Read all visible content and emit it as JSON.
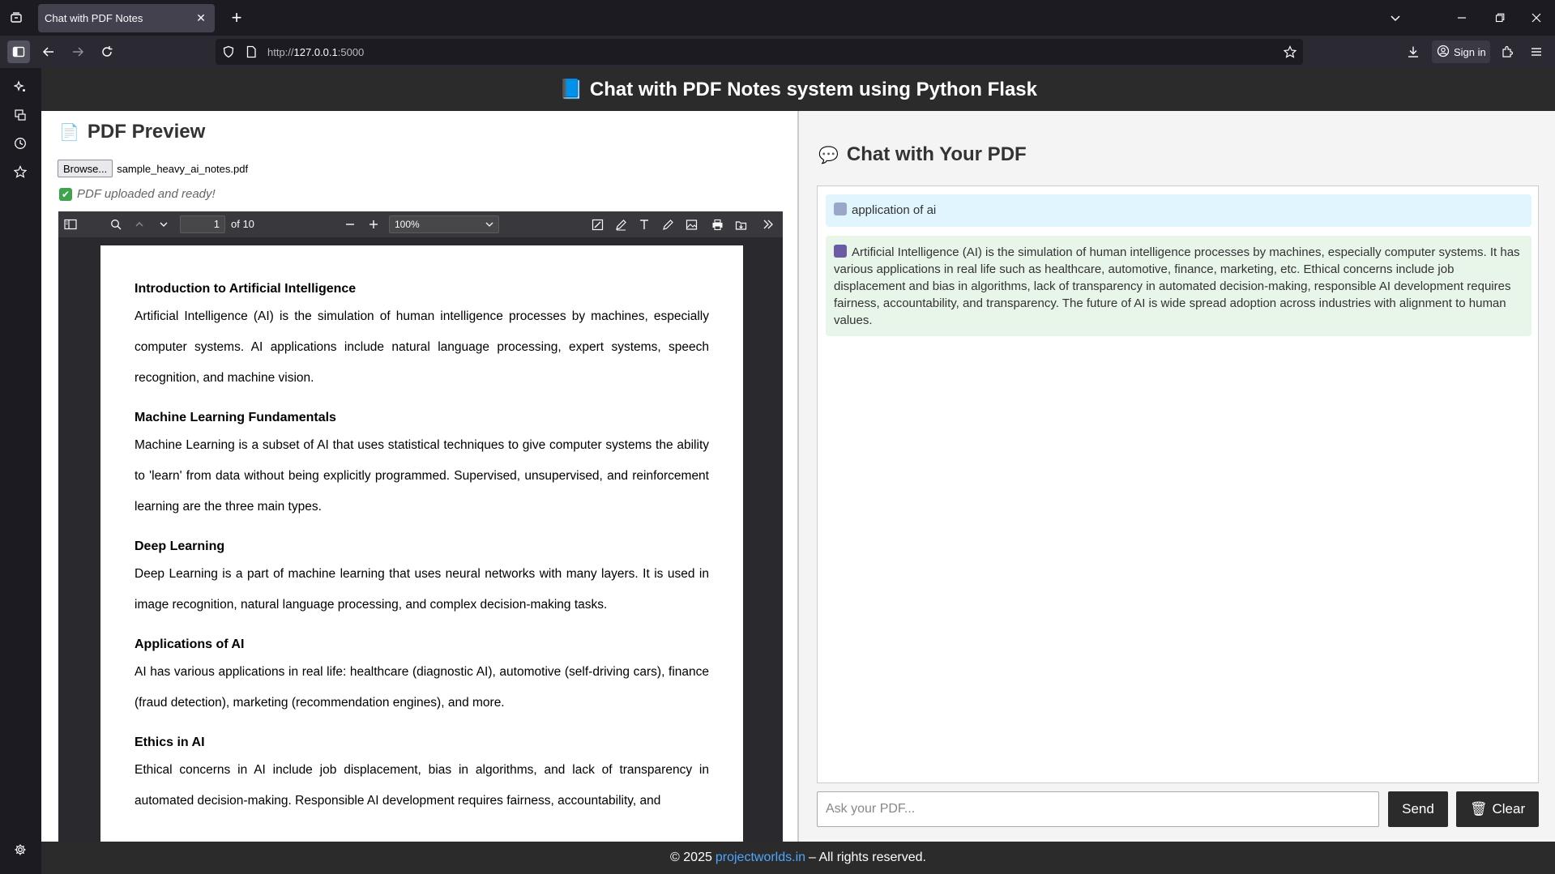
{
  "browser": {
    "tab_title": "Chat with PDF Notes",
    "tab_close": "✕",
    "new_tab": "+",
    "url_prefix": "http://",
    "url_host": "127.0.0.1",
    "url_port": ":5000",
    "sign_in": "Sign in"
  },
  "header": {
    "icon": "📘",
    "title": "Chat with PDF Notes system using Python Flask"
  },
  "left": {
    "icon": "📄",
    "title": "PDF Preview",
    "browse_label": "Browse...",
    "file_name": "sample_heavy_ai_notes.pdf",
    "status_icon": "✔",
    "status_text": "PDF uploaded and ready!"
  },
  "viewer": {
    "page_number": "1",
    "page_of": "of 10",
    "zoom": "100%",
    "sections": [
      {
        "heading": "Introduction to Artificial Intelligence",
        "body": "Artificial Intelligence (AI) is the simulation of human intelligence processes by machines, especially computer systems. AI applications include natural language processing, expert systems, speech recognition, and machine vision."
      },
      {
        "heading": "Machine Learning Fundamentals",
        "body": "Machine Learning is a subset of AI that uses statistical techniques to give computer systems the ability to 'learn' from data without being explicitly programmed. Supervised, unsupervised, and reinforcement learning are the three main types."
      },
      {
        "heading": "Deep Learning",
        "body": "Deep Learning is a part of machine learning that uses neural networks with many layers. It is used in image recognition, natural language processing, and complex decision-making tasks."
      },
      {
        "heading": "Applications of AI",
        "body": "AI has various applications in real life: healthcare (diagnostic AI), automotive (self-driving cars), finance (fraud detection), marketing (recommendation engines), and more."
      },
      {
        "heading": "Ethics in AI",
        "body": "Ethical concerns in AI include job displacement, bias in algorithms, and lack of transparency in automated decision-making. Responsible AI development requires fairness, accountability, and"
      }
    ]
  },
  "right": {
    "icon": "💬",
    "title": "Chat with Your PDF",
    "user_message": "application of ai",
    "bot_message": "Artificial Intelligence (AI) is the simulation of human intelligence processes by machines, especially computer systems. It has various applications in real life such as healthcare, automotive, finance, marketing, etc. Ethical concerns include job displacement and bias in algorithms, lack of transparency in automated decision-making, responsible AI development requires fairness, accountability, and transparency. The future of AI is wide spread adoption across industries with alignment to human values.",
    "input_placeholder": "Ask your PDF...",
    "send_label": "Send",
    "clear_icon": "🗑",
    "clear_label": "Clear"
  },
  "footer": {
    "prefix": "© 2025",
    "link": "projectworlds.in",
    "suffix": "– All rights reserved."
  }
}
